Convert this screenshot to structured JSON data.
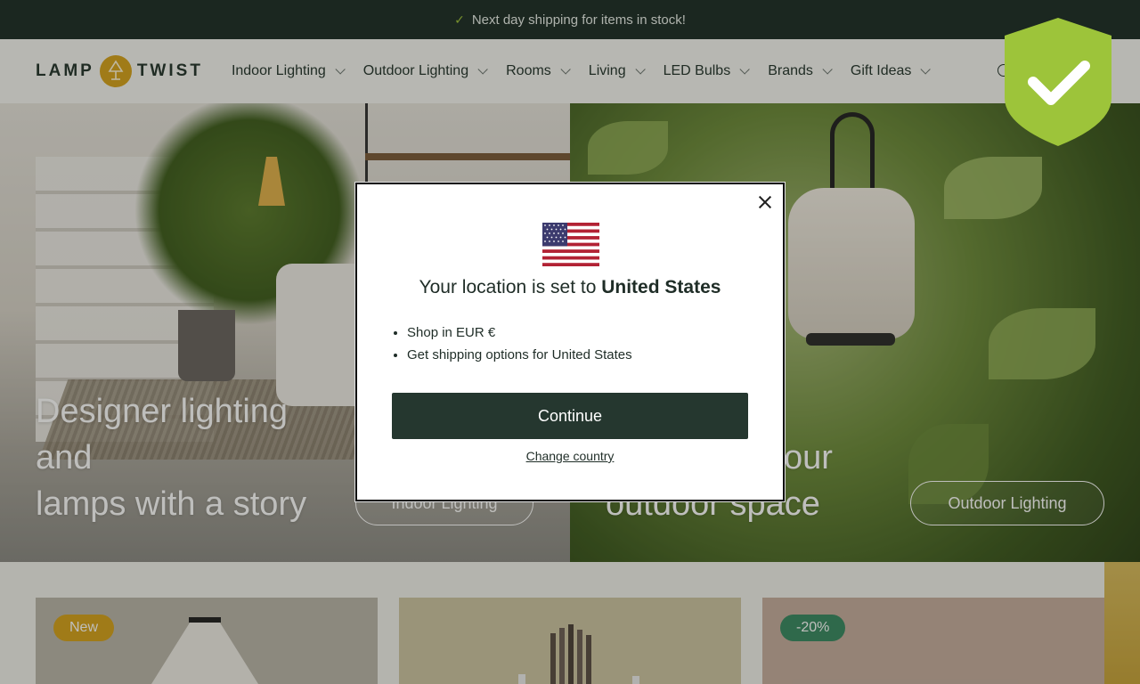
{
  "announcement": {
    "text": "Next day shipping for items in stock!"
  },
  "brand": {
    "left": "LAMP",
    "right": "TWIST"
  },
  "nav": [
    {
      "label": "Indoor Lighting"
    },
    {
      "label": "Outdoor Lighting"
    },
    {
      "label": "Rooms"
    },
    {
      "label": "Living"
    },
    {
      "label": "LED Bulbs"
    },
    {
      "label": "Brands"
    },
    {
      "label": "Gift Ideas"
    }
  ],
  "hero": {
    "left_title_line1": "Designer lighting",
    "left_title_line2": "and",
    "left_title_line3": "lamps with a story",
    "left_button": "Indoor Lighting",
    "right_title_line1": "our",
    "right_title_line2": "outdoor space",
    "right_button": "Outdoor Lighting"
  },
  "products": [
    {
      "badge": "New",
      "badge_color": "#d6a21c"
    },
    {
      "badge": ""
    },
    {
      "badge": "-20%",
      "badge_color": "#3a8a63"
    }
  ],
  "modal": {
    "title_prefix": "Your location is set to",
    "country": "United States",
    "bullets": [
      "Shop in EUR €",
      "Get shipping options for United States"
    ],
    "continue_label": "Continue",
    "change_label": "Change country"
  },
  "colors": {
    "dark_green": "#1e2e27",
    "button_green": "#25372f",
    "accent_gold": "#d6a21c",
    "shield_green": "#9dc43a"
  }
}
